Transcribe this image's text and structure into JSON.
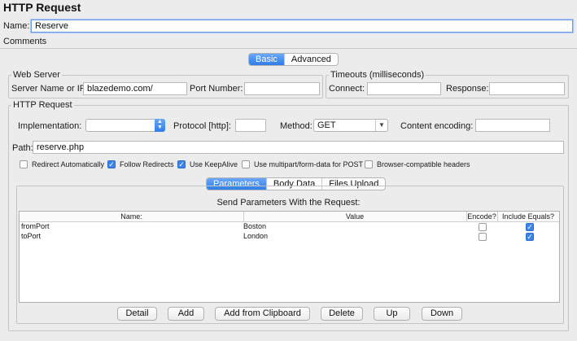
{
  "window": {
    "title": "HTTP Request"
  },
  "name": {
    "label": "Name:",
    "value": "Reserve"
  },
  "comments": {
    "label": "Comments:"
  },
  "mode_tabs": {
    "basic": "Basic",
    "advanced": "Advanced",
    "selected": "Basic"
  },
  "web_server": {
    "legend": "Web Server",
    "server_label": "Server Name or IP:",
    "server_value": "blazedemo.com/",
    "port_label": "Port Number:",
    "port_value": ""
  },
  "timeouts": {
    "legend": "Timeouts (milliseconds)",
    "connect_label": "Connect:",
    "connect_value": "",
    "response_label": "Response:",
    "response_value": ""
  },
  "http_request": {
    "legend": "HTTP Request",
    "implementation_label": "Implementation:",
    "implementation_value": "",
    "protocol_label": "Protocol [http]:",
    "protocol_value": "",
    "method_label": "Method:",
    "method_value": "GET",
    "encoding_label": "Content encoding:",
    "encoding_value": "",
    "path_label": "Path:",
    "path_value": "reserve.php",
    "options": [
      {
        "label": "Redirect Automatically",
        "checked": false
      },
      {
        "label": "Follow Redirects",
        "checked": true
      },
      {
        "label": "Use KeepAlive",
        "checked": true
      },
      {
        "label": "Use multipart/form-data for POST",
        "checked": false
      },
      {
        "label": "Browser-compatible headers",
        "checked": false
      }
    ]
  },
  "body_tabs": {
    "parameters": "Parameters",
    "body_data": "Body Data",
    "files_upload": "Files Upload",
    "selected": "Parameters"
  },
  "params": {
    "caption": "Send Parameters With the Request:",
    "columns": {
      "name": "Name:",
      "value": "Value",
      "encode": "Encode?",
      "include_equals": "Include Equals?"
    },
    "rows": [
      {
        "name": "fromPort",
        "value": "Boston",
        "encode": false,
        "include_equals": true
      },
      {
        "name": "toPort",
        "value": "London",
        "encode": false,
        "include_equals": true
      }
    ]
  },
  "buttons": {
    "detail": "Detail",
    "add": "Add",
    "add_from_clipboard": "Add from Clipboard",
    "delete": "Delete",
    "up": "Up",
    "down": "Down"
  }
}
